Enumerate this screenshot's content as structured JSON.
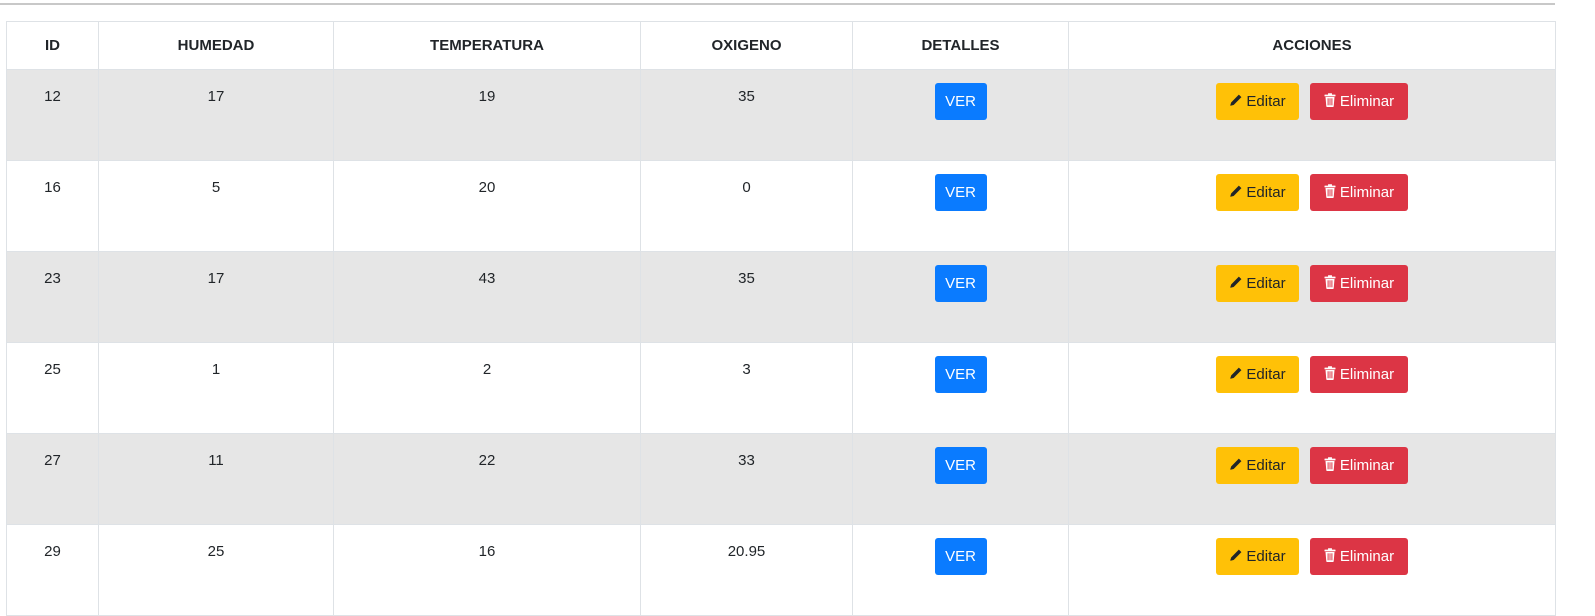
{
  "table": {
    "headers": [
      "ID",
      "HUMEDAD",
      "TEMPERATURA",
      "OXIGENO",
      "DETALLES",
      "ACCIONES"
    ],
    "rows": [
      {
        "id": "12",
        "humedad": "17",
        "temperatura": "19",
        "oxigeno": "35"
      },
      {
        "id": "16",
        "humedad": "5",
        "temperatura": "20",
        "oxigeno": "0"
      },
      {
        "id": "23",
        "humedad": "17",
        "temperatura": "43",
        "oxigeno": "35"
      },
      {
        "id": "25",
        "humedad": "1",
        "temperatura": "2",
        "oxigeno": "3"
      },
      {
        "id": "27",
        "humedad": "11",
        "temperatura": "22",
        "oxigeno": "33"
      },
      {
        "id": "29",
        "humedad": "25",
        "temperatura": "16",
        "oxigeno": "20.95"
      }
    ]
  },
  "buttons": {
    "ver_label": "VER",
    "edit_label": "Editar",
    "delete_label": "Eliminar",
    "edit_icon": "pencil-icon",
    "delete_icon": "trash-icon"
  },
  "colors": {
    "ver": "#0a7bff",
    "edit": "#ffc107",
    "delete": "#dc3545",
    "stripe": "#e6e6e6"
  }
}
